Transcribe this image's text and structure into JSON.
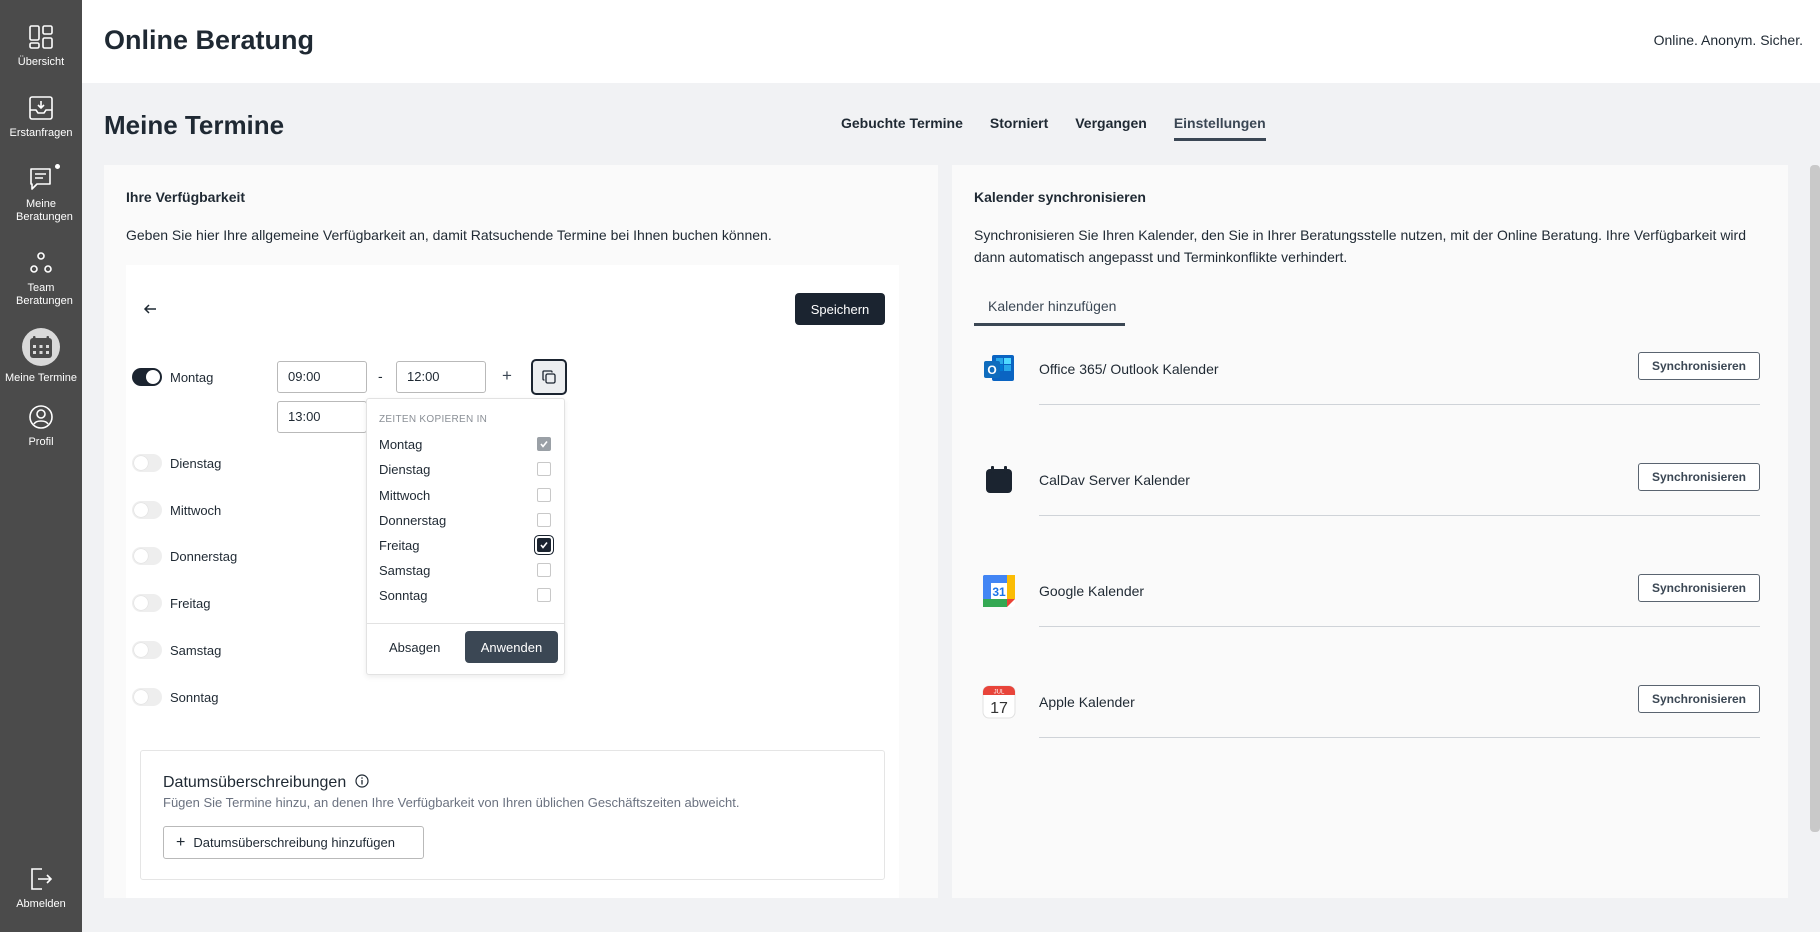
{
  "sidebar": {
    "items": [
      {
        "label": "Übersicht",
        "icon": "dashboard-icon"
      },
      {
        "label": "Erstanfragen",
        "icon": "inbox-icon"
      },
      {
        "label": "Meine Beratungen",
        "icon": "chat-icon"
      },
      {
        "label": "Team Beratungen",
        "icon": "team-icon"
      },
      {
        "label": "Meine Termine",
        "icon": "calendar-icon"
      },
      {
        "label": "Profil",
        "icon": "user-icon"
      }
    ],
    "logout": {
      "label": "Abmelden",
      "icon": "logout-icon"
    }
  },
  "header": {
    "title": "Online Beratung",
    "tagline": "Online. Anonym. Sicher."
  },
  "page": {
    "title": "Meine Termine",
    "tabs": [
      "Gebuchte Termine",
      "Storniert",
      "Vergangen",
      "Einstellungen"
    ],
    "active_tab": "Einstellungen"
  },
  "availability": {
    "title": "Ihre Verfügbarkeit",
    "description": "Geben Sie hier Ihre allgemeine Verfügbarkeit an, damit Ratsuchende Termine bei Ihnen buchen können.",
    "save_label": "Speichern",
    "days": [
      {
        "label": "Montag",
        "enabled": true
      },
      {
        "label": "Dienstag",
        "enabled": false
      },
      {
        "label": "Mittwoch",
        "enabled": false
      },
      {
        "label": "Donnerstag",
        "enabled": false
      },
      {
        "label": "Freitag",
        "enabled": false
      },
      {
        "label": "Samstag",
        "enabled": false
      },
      {
        "label": "Sonntag",
        "enabled": false
      }
    ],
    "monday_slots": {
      "start1": "09:00",
      "dash": "-",
      "end1": "12:00",
      "start2": "13:00",
      "add_symbol": "+"
    }
  },
  "copy_popover": {
    "heading": "ZEITEN KOPIEREN IN",
    "items": [
      {
        "label": "Montag",
        "checked": true
      },
      {
        "label": "Dienstag",
        "checked": false
      },
      {
        "label": "Mittwoch",
        "checked": false
      },
      {
        "label": "Donnerstag",
        "checked": false
      },
      {
        "label": "Freitag",
        "checked": true
      },
      {
        "label": "Samstag",
        "checked": false
      },
      {
        "label": "Sonntag",
        "checked": false
      }
    ],
    "cancel_label": "Absagen",
    "apply_label": "Anwenden"
  },
  "date_override": {
    "title": "Datumsüberschreibungen",
    "description": "Fügen Sie Termine hinzu, an denen Ihre Verfügbarkeit von Ihren üblichen Geschäftszeiten abweicht.",
    "add_label": "Datumsüberschreibung hinzufügen",
    "add_symbol": "+"
  },
  "calendar_sync": {
    "title": "Kalender synchronisieren",
    "description": "Synchronisieren Sie Ihren Kalender, den Sie in Ihrer Beratungsstelle nutzen, mit der Online Beratung. Ihre Verfügbarkeit wird dann automatisch angepasst und Terminkonflikte verhindert.",
    "tab_label": "Kalender hinzufügen",
    "sync_label": "Synchronisieren",
    "calendars": [
      {
        "name": "Office 365/ Outlook Kalender",
        "icon": "outlook-icon"
      },
      {
        "name": "CalDav Server Kalender",
        "icon": "caldav-icon"
      },
      {
        "name": "Google Kalender",
        "icon": "google-calendar-icon",
        "logo_text": "31"
      },
      {
        "name": "Apple Kalender",
        "icon": "apple-calendar-icon",
        "logo_month": "JUL",
        "logo_day": "17"
      }
    ]
  },
  "colors": {
    "sidebar_bg": "#4b4b4b",
    "primary_dark": "#1b2430",
    "page_bg": "#f1f2f4"
  }
}
